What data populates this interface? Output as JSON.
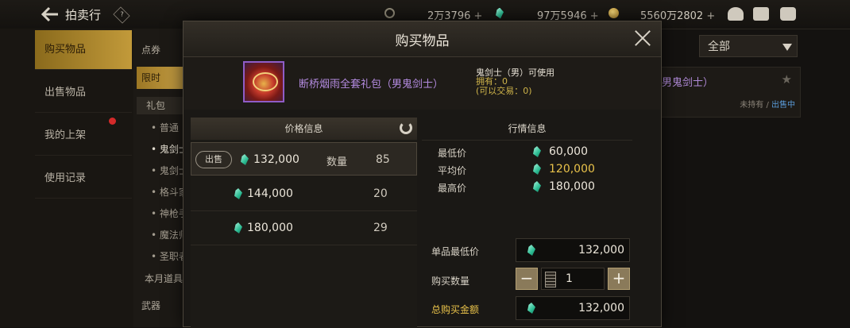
{
  "topbar": {
    "title": "拍卖行",
    "help": "?",
    "currencies": [
      {
        "icon": "c-coin-icon",
        "value": "2万3796"
      },
      {
        "icon": "gem-icon",
        "value": "97万5946"
      },
      {
        "icon": "gold-coin-icon",
        "value": "5560万2802"
      }
    ],
    "plus": "+"
  },
  "sidebar": {
    "items": [
      {
        "label": "购买物品",
        "active": true
      },
      {
        "label": "出售物品"
      },
      {
        "label": "我的上架"
      },
      {
        "label": "使用记录"
      }
    ]
  },
  "categories": {
    "top": "点券",
    "limited": "限时",
    "gift": "礼包",
    "subs": [
      "• 普通",
      "• 鬼剑士",
      "• 鬼剑士",
      "• 格斗家",
      "• 神枪手",
      "• 魔法师",
      "• 圣职者"
    ],
    "weekly": "本月道具",
    "weapon": "武器"
  },
  "filter": {
    "selected": "全部"
  },
  "bg_item": {
    "name": "男鬼剑士）",
    "status_pre": "未持有 / ",
    "status_b": "出售中"
  },
  "modal": {
    "title": "购买物品",
    "item": {
      "name": "断桥烟雨全套礼包（男鬼剑士）",
      "usable": "鬼剑士（男）可使用",
      "owned": "拥有：0",
      "tradable": "(可以交易：0)"
    },
    "price_panel": {
      "header": "价格信息",
      "sell_badge": "出售",
      "qty_label": "数量",
      "rows": [
        {
          "price": "132,000",
          "qty": "85"
        },
        {
          "price": "144,000",
          "qty": "20"
        },
        {
          "price": "180,000",
          "qty": "29"
        }
      ]
    },
    "market": {
      "header": "行情信息",
      "rows": [
        {
          "label": "最低价",
          "value": "60,000"
        },
        {
          "label": "平均价",
          "value": "120,000"
        },
        {
          "label": "最高价",
          "value": "180,000"
        }
      ]
    },
    "purchase": {
      "unit_label": "单品最低价",
      "unit_value": "132,000",
      "qty_label": "购买数量",
      "qty_value": "1",
      "minus": "−",
      "plus": "+",
      "total_label": "总购买金额",
      "total_value": "132,000"
    }
  },
  "colors": {
    "accent": "#c29a3a",
    "gem": "#2cbc93",
    "avg_price": "#e9c24a",
    "item_name": "#b48be0"
  }
}
